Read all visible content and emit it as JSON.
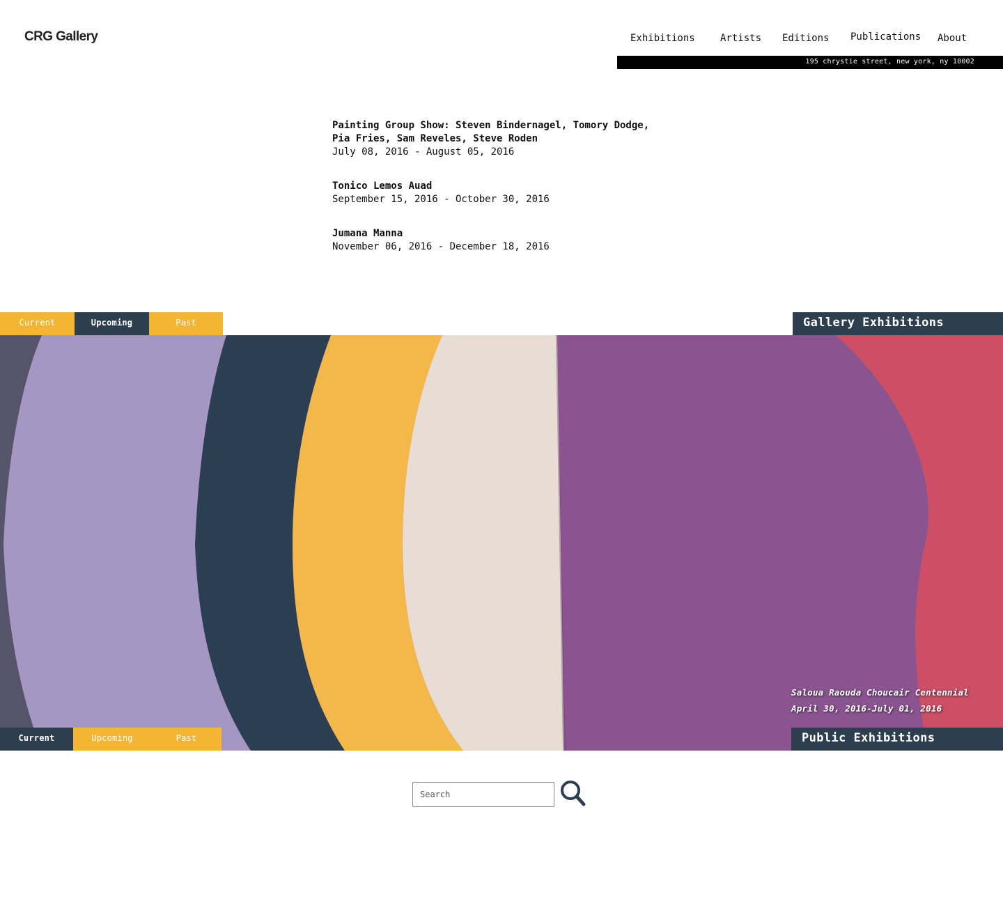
{
  "header": {
    "logo": "CRG Gallery",
    "nav": [
      "Exhibitions",
      "Artists",
      "Editions",
      "Publications",
      "About"
    ],
    "address": "195 chrystie street, new york, ny 10002"
  },
  "exhibitions": [
    {
      "title_line1": "Painting Group Show: Steven Bindernagel, Tomory Dodge,",
      "title_line2": "Pia Fries, Sam Reveles, Steve Roden",
      "dates": "July 08, 2016 - August 05, 2016"
    },
    {
      "title": "Tonico Lemos Auad",
      "dates": "September 15, 2016 - October 30, 2016"
    },
    {
      "title": "Jumana Manna",
      "dates": "November 06, 2016 - December 18, 2016"
    }
  ],
  "gallery_section": {
    "tabs": [
      "Current",
      "Upcoming",
      "Past"
    ],
    "active_tab": "Upcoming",
    "label": "Gallery Exhibitions"
  },
  "hero": {
    "caption_title": "Saloua Raouda Choucair Centennial",
    "caption_dates": "April 30, 2016-July 01, 2016",
    "colors": {
      "slate": "#55546a",
      "lavender": "#a596c2",
      "navy": "#2c3e52",
      "yellow": "#f4b84a",
      "cream": "#e8ddd2",
      "purple": "#8a5490",
      "red": "#cc4f65"
    }
  },
  "public_section": {
    "tabs": [
      "Current",
      "Upcoming",
      "Past"
    ],
    "active_tab": "Current",
    "label": "Public Exhibitions"
  },
  "search": {
    "placeholder": "Search",
    "icon": "search-icon"
  },
  "colors": {
    "accent_yellow": "#f4b532",
    "dark_slate": "#2d3e4e"
  }
}
